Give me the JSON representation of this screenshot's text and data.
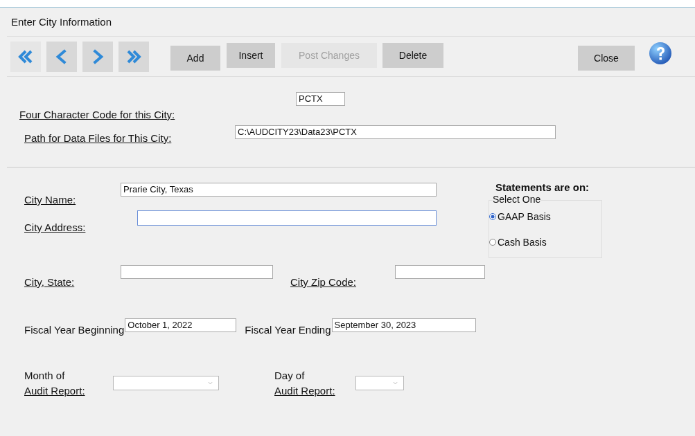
{
  "window": {
    "title": "Enter City Information"
  },
  "toolbar": {
    "nav_buttons": [
      {
        "kind": "first"
      },
      {
        "kind": "previous"
      },
      {
        "kind": "next"
      },
      {
        "kind": "last"
      }
    ],
    "buttons": [
      {
        "label": "Add",
        "disabled": false
      },
      {
        "label": "Insert",
        "disabled": false
      },
      {
        "label": "Post Changes",
        "disabled": true
      },
      {
        "label": "Delete",
        "disabled": false
      }
    ],
    "close_button": "Close"
  },
  "city_code": {
    "label": "Four Character Code for this City:",
    "value": "PCTX"
  },
  "data_path": {
    "label": "Path for Data Files for This City:",
    "value": "C:\\AUDCITY23\\Data23\\PCTX"
  },
  "city_name": {
    "label": "City Name:",
    "value": "Prarie City, Texas"
  },
  "city_address": {
    "label": "City Address:",
    "focused": true
  },
  "city_state": {
    "label": "City, State:"
  },
  "zip_code": {
    "label": "City Zip Code:"
  },
  "statements": {
    "heading": "Statements are on:",
    "group_label": "Select One",
    "options": [
      {
        "label": "GAAP Basis",
        "selected": true
      },
      {
        "label": "Cash Basis",
        "selected": false
      }
    ]
  },
  "fiscal_begin": {
    "label": "Fiscal Year Beginning",
    "value": "October 1, 2022"
  },
  "fiscal_end": {
    "label": "Fiscal Year Ending",
    "value": "September 30, 2023"
  },
  "audit_month": {
    "label_lines": [
      {
        "text": "Month of",
        "underlined": false
      },
      {
        "text": "Audit Report:",
        "underlined": true
      }
    ]
  },
  "audit_day": {
    "label_lines": [
      {
        "text": "Day of",
        "underlined": false
      },
      {
        "text": "Audit Report:",
        "underlined": true
      }
    ]
  }
}
